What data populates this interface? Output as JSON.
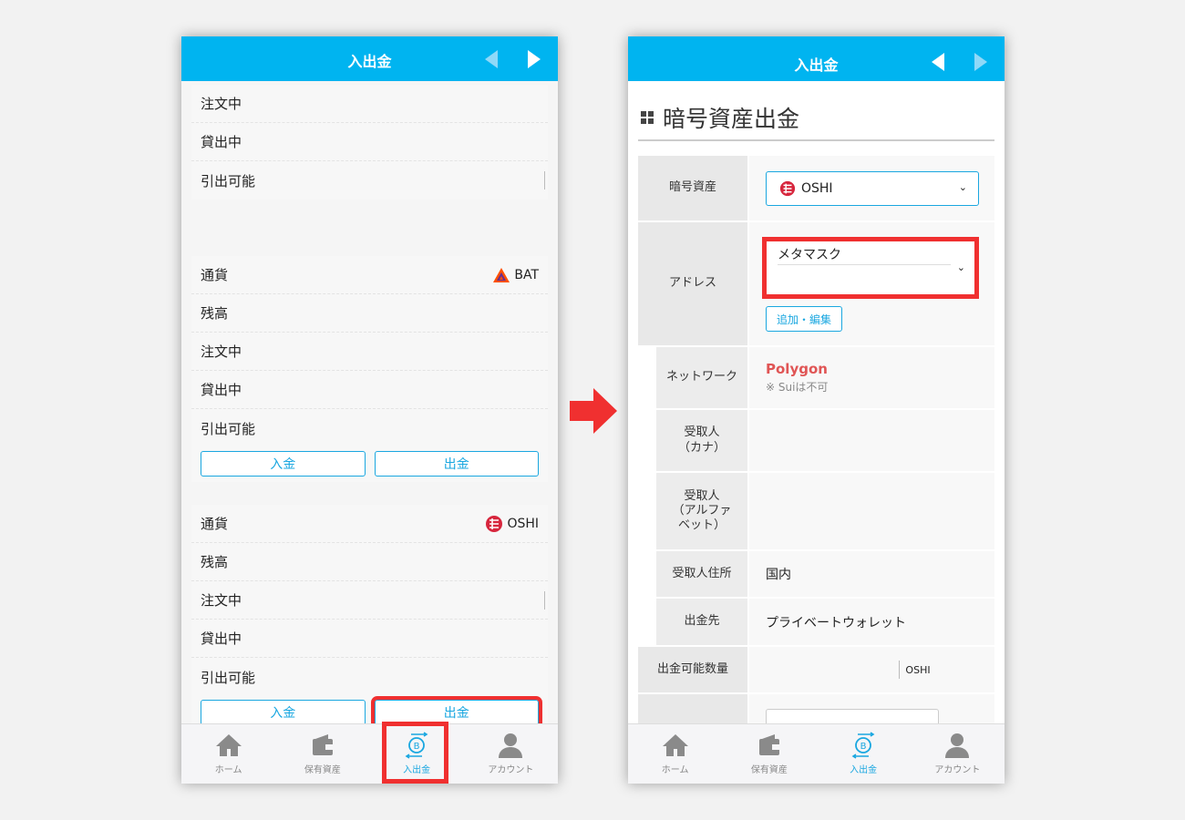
{
  "header": {
    "title": "入出金"
  },
  "left": {
    "card1": {
      "rows": [
        "注文中",
        "貸出中",
        "引出可能"
      ]
    },
    "card2": {
      "currency_label": "通貨",
      "currency_value": "BAT",
      "rows": [
        "残高",
        "注文中",
        "貸出中",
        "引出可能"
      ],
      "deposit_label": "入金",
      "withdraw_label": "出金"
    },
    "card3": {
      "currency_label": "通貨",
      "currency_value": "OSHI",
      "rows": [
        "残高",
        "注文中",
        "貸出中",
        "引出可能"
      ],
      "deposit_label": "入金",
      "withdraw_label": "出金"
    }
  },
  "nav": {
    "items": [
      {
        "label": "ホーム",
        "icon": "home-icon"
      },
      {
        "label": "保有資産",
        "icon": "wallet-icon"
      },
      {
        "label": "入出金",
        "icon": "deposit-withdraw-icon"
      },
      {
        "label": "アカウント",
        "icon": "account-icon"
      }
    ]
  },
  "right": {
    "section_title": "暗号資産出金",
    "asset_label": "暗号資産",
    "asset_value": "OSHI",
    "address_label": "アドレス",
    "address_value": "メタマスク",
    "address_edit_label": "追加・編集",
    "network_label": "ネットワーク",
    "network_value": "Polygon",
    "network_note": "※ Suiは不可",
    "recipient_kana_label": "受取人\n（カナ）",
    "recipient_alpha_label": "受取人\n（アルファ\nベット）",
    "recipient_address_label": "受取人住所",
    "recipient_address_value": "国内",
    "destination_label": "出金先",
    "destination_value": "プライベートウォレット",
    "available_label": "出金可能数量",
    "available_unit": "OSHI"
  },
  "colors": {
    "accent": "#00b4f0",
    "highlight": "#f03030",
    "polygon": "#e05555"
  }
}
